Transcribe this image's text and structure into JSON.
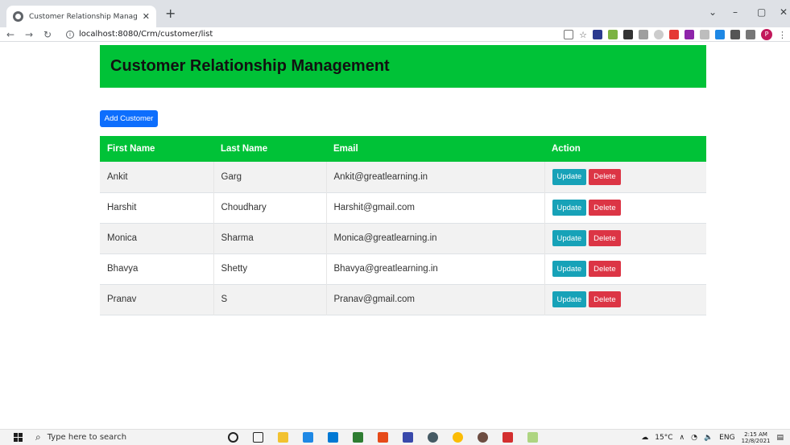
{
  "browser": {
    "tab_title": "Customer Relationship Managemen",
    "tab_close": "✕",
    "new_tab": "+",
    "url": "localhost:8080/Crm/customer/list",
    "profile_initial": "P"
  },
  "page": {
    "title": "Customer Relationship Management",
    "add_button": "Add Customer"
  },
  "table": {
    "headers": [
      "First Name",
      "Last Name",
      "Email",
      "Action"
    ],
    "rows": [
      {
        "first": "Ankit",
        "last": "Garg",
        "email": "Ankit@greatlearning.in"
      },
      {
        "first": "Harshit",
        "last": "Choudhary",
        "email": "Harshit@gmail.com"
      },
      {
        "first": "Monica",
        "last": "Sharma",
        "email": "Monica@greatlearning.in"
      },
      {
        "first": "Bhavya",
        "last": "Shetty",
        "email": "Bhavya@greatlearning.in"
      },
      {
        "first": "Pranav",
        "last": "S",
        "email": "Pranav@gmail.com"
      }
    ],
    "update_label": "Update",
    "delete_label": "Delete"
  },
  "taskbar": {
    "search_placeholder": "Type here to search",
    "temperature": "15°C",
    "language": "ENG",
    "time": "2:15 AM",
    "date": "12/8/2021"
  },
  "colors": {
    "header_green": "#00c237",
    "primary_blue": "#0d6efd",
    "update_teal": "#17a2b8",
    "delete_red": "#dc3545"
  }
}
